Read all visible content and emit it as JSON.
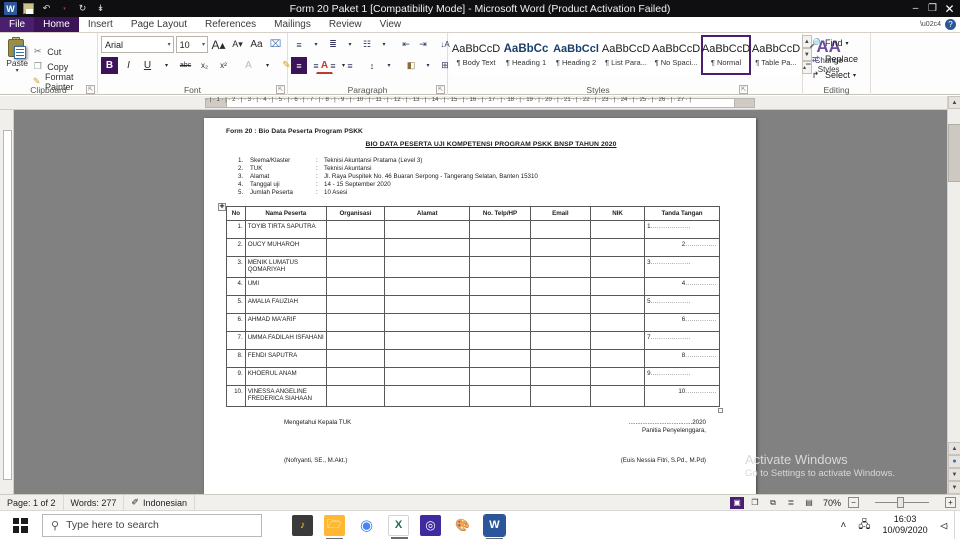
{
  "titlebar": {
    "title": "Form 20 Paket 1 [Compatibility Mode]  -  Microsoft Word (Product Activation Failed)",
    "word_logo": "W",
    "qat": [
      {
        "name": "save-icon",
        "glyph": ""
      },
      {
        "name": "undo-icon",
        "glyph": "↶"
      },
      {
        "name": "undo-dropdown-icon",
        "glyph": "▾"
      },
      {
        "name": "redo-icon",
        "glyph": "↻"
      },
      {
        "name": "customize-qat-icon",
        "glyph": "↡"
      }
    ],
    "controls": {
      "minimize": "‒",
      "restore": "❐",
      "close": "✕"
    }
  },
  "ribbon_tabs": [
    {
      "label": "File",
      "kind": "file"
    },
    {
      "label": "Home",
      "kind": "active"
    },
    {
      "label": "Insert",
      "kind": "normal"
    },
    {
      "label": "Page Layout",
      "kind": "normal"
    },
    {
      "label": "References",
      "kind": "normal"
    },
    {
      "label": "Mailings",
      "kind": "normal"
    },
    {
      "label": "Review",
      "kind": "normal"
    },
    {
      "label": "View",
      "kind": "normal"
    }
  ],
  "ribbon": {
    "clipboard": {
      "group_label": "Clipboard",
      "paste_label": "Paste",
      "items": [
        {
          "label": "Cut",
          "icon": "scissors-icon",
          "glyph": "✂"
        },
        {
          "label": "Copy",
          "icon": "copy-icon",
          "glyph": "❐"
        },
        {
          "label": "Format Painter",
          "icon": "format-painter-icon",
          "glyph": "✎"
        }
      ]
    },
    "font": {
      "group_label": "Font",
      "font_name": "Arial",
      "font_size": "10",
      "row1": [
        {
          "name": "grow-font-button",
          "glyph": "A▴"
        },
        {
          "name": "shrink-font-button",
          "glyph": "A▾"
        },
        {
          "name": "change-case-button",
          "glyph": "Aa"
        },
        {
          "name": "clear-formatting-button",
          "glyph": "⌧"
        }
      ],
      "row2": [
        {
          "name": "bold-button",
          "glyph": "B",
          "active": true
        },
        {
          "name": "italic-button",
          "glyph": "I",
          "active": false
        },
        {
          "name": "underline-button",
          "glyph": "U",
          "active": false
        },
        {
          "name": "underline-dropdown-icon",
          "glyph": "▾",
          "active": false
        },
        {
          "name": "strikethrough-button",
          "glyph": "abc",
          "active": false
        },
        {
          "name": "subscript-button",
          "glyph": "x₂",
          "active": false
        },
        {
          "name": "superscript-button",
          "glyph": "x²",
          "active": false
        },
        {
          "name": "text-effects-button",
          "glyph": "A",
          "active": false
        },
        {
          "name": "text-highlight-color-button",
          "glyph": "✎",
          "active": false
        },
        {
          "name": "font-color-button",
          "glyph": "A",
          "active": false
        }
      ]
    },
    "paragraph": {
      "group_label": "Paragraph",
      "row1": [
        {
          "name": "bullets-button",
          "glyph": "≡"
        },
        {
          "name": "numbering-button",
          "glyph": "≣"
        },
        {
          "name": "multilevel-list-button",
          "glyph": "☷"
        },
        {
          "name": "decrease-indent-button",
          "glyph": "⇤"
        },
        {
          "name": "increase-indent-button",
          "glyph": "⇥"
        },
        {
          "name": "sort-button",
          "glyph": "↓A"
        },
        {
          "name": "show-formatting-marks-button",
          "glyph": "¶"
        }
      ],
      "row2": [
        {
          "name": "align-left-button",
          "glyph": "≡",
          "active": true
        },
        {
          "name": "align-center-button",
          "glyph": "≡",
          "active": false
        },
        {
          "name": "align-right-button",
          "glyph": "≡",
          "active": false
        },
        {
          "name": "justify-button",
          "glyph": "≡",
          "active": false
        },
        {
          "name": "line-spacing-button",
          "glyph": "↕",
          "active": false
        },
        {
          "name": "shading-button",
          "glyph": "◧",
          "active": false
        },
        {
          "name": "borders-button",
          "glyph": "⊞",
          "active": false
        }
      ]
    },
    "styles": {
      "group_label": "Styles",
      "gallery": [
        {
          "preview": "AaBbCcD",
          "name": "¶ Body Text",
          "kind": "normal",
          "selected": false
        },
        {
          "preview": "AaBbCc",
          "name": "¶ Heading 1",
          "kind": "h1",
          "selected": false
        },
        {
          "preview": "AaBbCcl",
          "name": "¶ Heading 2",
          "kind": "h2",
          "selected": false
        },
        {
          "preview": "AaBbCcD",
          "name": "¶ List Para...",
          "kind": "normal",
          "selected": false
        },
        {
          "preview": "AaBbCcD",
          "name": "¶ No Spaci...",
          "kind": "normal",
          "selected": false
        },
        {
          "preview": "AaBbCcD",
          "name": "¶ Normal",
          "kind": "normal",
          "selected": true
        },
        {
          "preview": "AaBbCcD",
          "name": "¶ Table Pa...",
          "kind": "normal",
          "selected": false
        }
      ],
      "change_styles_label_1": "Change",
      "change_styles_label_2": "Styles",
      "change_styles_glyph": "AA"
    },
    "editing": {
      "group_label": "Editing",
      "items": [
        {
          "label": "Find",
          "icon": "binoculars-icon",
          "glyph": "🔍",
          "caret": "▾"
        },
        {
          "label": "Replace",
          "icon": "replace-icon",
          "glyph": "⇄",
          "caret": ""
        },
        {
          "label": "Select",
          "icon": "select-icon",
          "glyph": "↱",
          "caret": "▾"
        }
      ]
    }
  },
  "ruler": {
    "ticks": "· | · 1 · | · 2 · | · 3 · | · 4 · | · 5 · | · 6 · | · 7 · | · 8 · | · 9 · | · 10 · | · 11 · | · 12 · | · 13 · | · 14 · | · 15 · | · 16 · | · 17 · | · 18 · | · 19 · | · 20 · | · 21 · | · 22 · | · 23 · | · 24 · | · 25 · | · 26 · | · 27 · |"
  },
  "document": {
    "form_line": "Form 20 : Bio Data Peserta Program PSKK",
    "title": "BIO DATA PESERTA UJI KOMPETENSI PROGRAM PSKK BNSP TAHUN 2020",
    "meta": [
      {
        "num": "1.",
        "key": "Skema/Klaster",
        "colon": ":",
        "value": "Teknisi Akuntansi Pratama (Level 3)"
      },
      {
        "num": "2.",
        "key": "TUK",
        "colon": ":",
        "value": "Teknisi Akuntansi"
      },
      {
        "num": "3.",
        "key": "Alamat",
        "colon": ":",
        "value": "Jl. Raya Puspitek No. 46 Buaran Serpong - Tangerang  Selatan, Banten 15310"
      },
      {
        "num": "4.",
        "key": "Tanggal uji",
        "colon": ":",
        "value": "14 - 15 September 2020"
      },
      {
        "num": "5.",
        "key": "Jumlah Peserta",
        "colon": ":",
        "value": "10 Asesi"
      }
    ],
    "table": {
      "headers": [
        "No",
        "Nama Peserta",
        "Organisasi",
        "Alamat",
        "No. Telp/HP",
        "Email",
        "NIK",
        "Tanda Tangan"
      ],
      "rows": [
        {
          "no": "1.",
          "name": "TOYIB TIRTA SAPUTRA",
          "org": "",
          "alamat": "",
          "telp": "",
          "email": "",
          "nik": "",
          "sig": "1",
          "sig_align": "left"
        },
        {
          "no": "2.",
          "name": "OUCY MUHAROH",
          "org": "",
          "alamat": "",
          "telp": "",
          "email": "",
          "nik": "",
          "sig": "2",
          "sig_align": "right"
        },
        {
          "no": "3.",
          "name": "MENIK LUMATUS QOMARIYAH",
          "org": "",
          "alamat": "",
          "telp": "",
          "email": "",
          "nik": "",
          "sig": "3",
          "sig_align": "left"
        },
        {
          "no": "4.",
          "name": "UMI",
          "org": "",
          "alamat": "",
          "telp": "",
          "email": "",
          "nik": "",
          "sig": "4",
          "sig_align": "right"
        },
        {
          "no": "5.",
          "name": "AMALIA FAUZIAH",
          "org": "",
          "alamat": "",
          "telp": "",
          "email": "",
          "nik": "",
          "sig": "5",
          "sig_align": "left"
        },
        {
          "no": "6.",
          "name": "AHMAD MA'ARIF",
          "org": "",
          "alamat": "",
          "telp": "",
          "email": "",
          "nik": "",
          "sig": "6",
          "sig_align": "right"
        },
        {
          "no": "7.",
          "name": "UMMA FADILAH ISFAHANI",
          "org": "",
          "alamat": "",
          "telp": "",
          "email": "",
          "nik": "",
          "sig": "7",
          "sig_align": "left"
        },
        {
          "no": "8.",
          "name": "FENDI SAPUTRA",
          "org": "",
          "alamat": "",
          "telp": "",
          "email": "",
          "nik": "",
          "sig": "8",
          "sig_align": "right"
        },
        {
          "no": "9.",
          "name": "KHOERUL ANAM",
          "org": "",
          "alamat": "",
          "telp": "",
          "email": "",
          "nik": "",
          "sig": "9",
          "sig_align": "left"
        },
        {
          "no": "10.",
          "name": "VINESSA ANGELINE FREDERICA SIAHAAN",
          "org": "",
          "alamat": "",
          "telp": "",
          "email": "",
          "nik": "",
          "sig": "10",
          "sig_align": "right"
        }
      ]
    },
    "footer": {
      "left_top": "Mengetahui Kepala TUK",
      "right_date": ".....................................2020",
      "right_top": "Panitia Penyelenggara,",
      "left_name": "(Nofryanti, SE., M.Akt.)",
      "right_name": "(Euis Nessia Fitri, S.Pd., M.Pd)"
    }
  },
  "status_bar": {
    "page": "Page: 1 of 2",
    "words": "Words: 277",
    "language": "Indonesian",
    "language_icon": "proofing-icon",
    "zoom": "70%",
    "view_buttons": [
      {
        "name": "print-layout-view-button",
        "glyph": "▣",
        "active": true
      },
      {
        "name": "full-screen-reading-view-button",
        "glyph": "❐",
        "active": false
      },
      {
        "name": "web-layout-view-button",
        "glyph": "⧉",
        "active": false
      },
      {
        "name": "outline-view-button",
        "glyph": "≣",
        "active": false
      },
      {
        "name": "draft-view-button",
        "glyph": "▤",
        "active": false
      }
    ],
    "zoom_out": "−",
    "zoom_in": "+"
  },
  "taskbar": {
    "search_placeholder": "Type here to search",
    "apps": [
      {
        "name": "sticky-notes-icon",
        "glyph": "♪",
        "bg": "#3a3a3a",
        "fg": "#ffd24a",
        "running": false
      },
      {
        "name": "file-explorer-icon",
        "glyph": "🗁",
        "bg": "#ffb833",
        "fg": "#ffffff",
        "running": true
      },
      {
        "name": "google-chrome-icon",
        "glyph": "◉",
        "bg": "transparent",
        "fg": "#4285f4",
        "running": false
      },
      {
        "name": "microsoft-excel-icon",
        "glyph": "X",
        "bg": "#ffffff",
        "fg": "#1d7044",
        "running": true
      },
      {
        "name": "instagram-icon",
        "glyph": "◎",
        "bg": "#3f2a9e",
        "fg": "#ffffff",
        "running": false
      },
      {
        "name": "paint-icon",
        "glyph": "🎨",
        "bg": "transparent",
        "fg": "#8a6ebf",
        "running": false
      },
      {
        "name": "microsoft-word-icon",
        "glyph": "W",
        "bg": "#2b579a",
        "fg": "#ffffff",
        "running": true
      }
    ],
    "tray": {
      "show_hidden": "˄",
      "network_icon": "🖧",
      "time": "16:03",
      "date": "10/09/2020",
      "action_center": "⬜"
    }
  },
  "watermark": {
    "title": "Activate Windows",
    "subtitle": "Go to Settings to activate Windows."
  }
}
